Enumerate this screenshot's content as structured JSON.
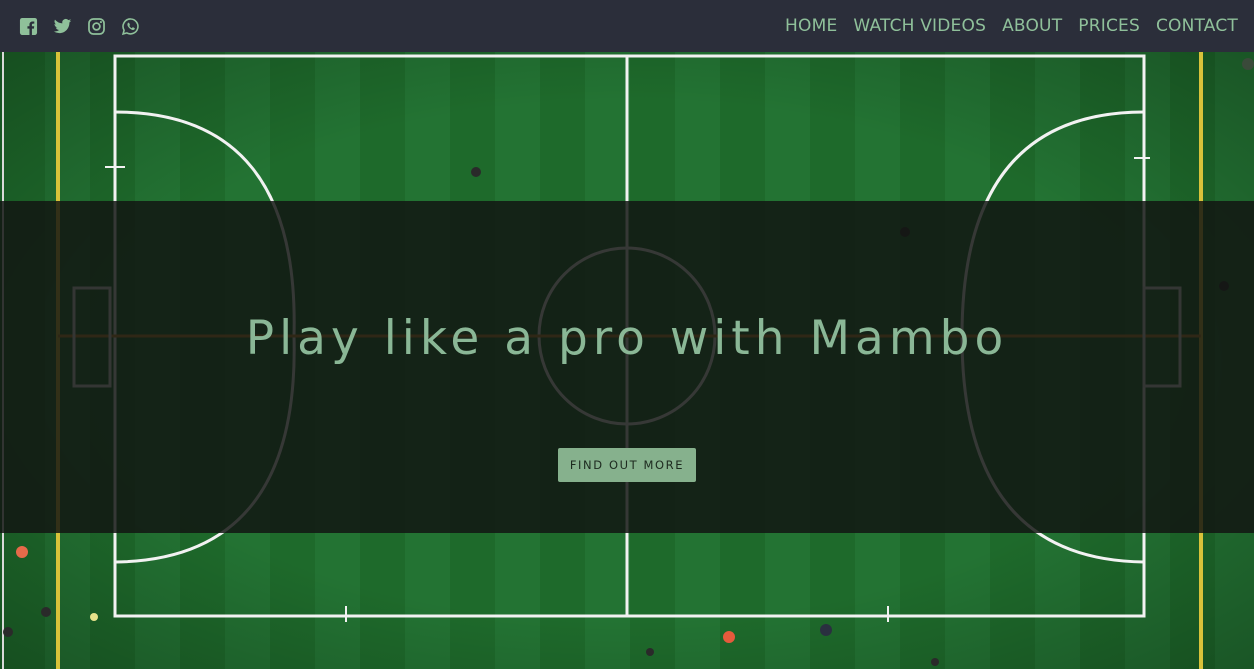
{
  "nav": {
    "social": [
      {
        "name": "facebook-icon"
      },
      {
        "name": "twitter-icon"
      },
      {
        "name": "instagram-icon"
      },
      {
        "name": "whatsapp-icon"
      }
    ],
    "links": [
      "HOME",
      "WATCH VIDEOS",
      "ABOUT",
      "PRICES",
      "CONTACT"
    ]
  },
  "hero": {
    "title": "Play like a pro with Mambo",
    "button_label": "FIND OUT MORE"
  },
  "colors": {
    "navbar_bg": "#2b2e3a",
    "accent": "#8fc09a",
    "button_bg": "#86b18d",
    "field_green": "#1f6b2a"
  }
}
